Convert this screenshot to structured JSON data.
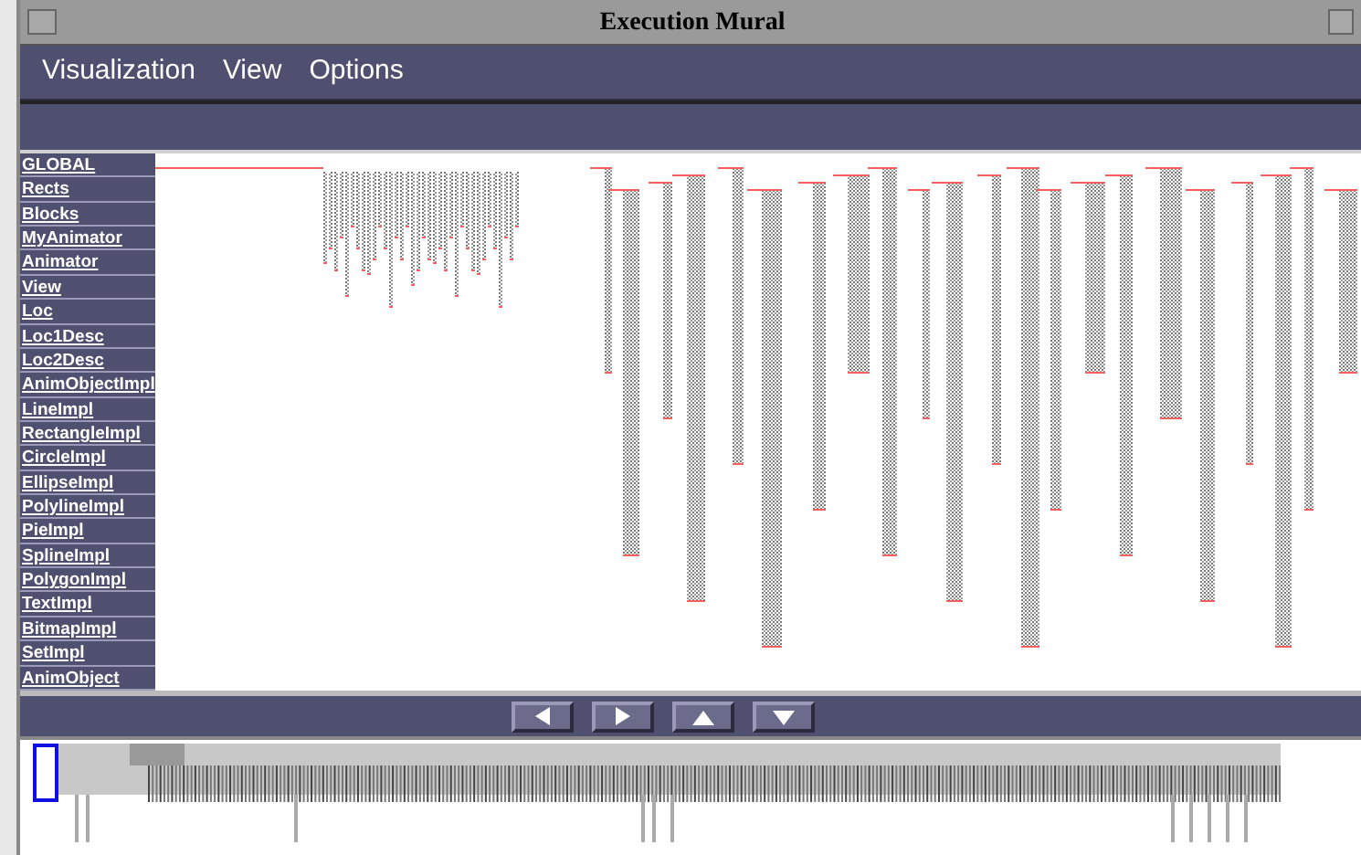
{
  "window": {
    "title": "Execution Mural"
  },
  "menu": [
    "Visualization",
    "View",
    "Options"
  ],
  "classes": [
    "GLOBAL",
    "Rects",
    "Blocks",
    "MyAnimator",
    "Animator",
    "View",
    "Loc",
    "Loc1Desc",
    "Loc2Desc",
    "AnimObjectImpl",
    "LineImpl",
    "RectangleImpl",
    "CircleImpl",
    "EllipseImpl",
    "PolylineImpl",
    "PieImpl",
    "SplineImpl",
    "PolygonImpl",
    "TextImpl",
    "BitmapImpl",
    "SetImpl",
    "AnimObject"
  ]
}
